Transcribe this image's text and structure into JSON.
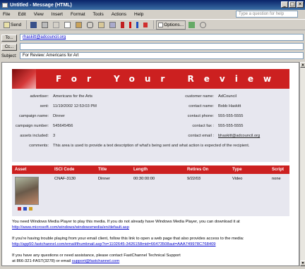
{
  "window": {
    "title": "Untitled - Message (HTML)",
    "minimize": "_",
    "maximize": "□",
    "close": "✕"
  },
  "menu": [
    "File",
    "Edit",
    "View",
    "Insert",
    "Format",
    "Tools",
    "Actions",
    "Help"
  ],
  "help_placeholder": "Type a question for help",
  "toolbar": {
    "send": "Send",
    "options": "Options..."
  },
  "header": {
    "to_label": "To...",
    "to_value": "rhaskitt@adcouncil.org",
    "cc_label": "Cc...",
    "cc_value": "",
    "subject_label": "Subject:",
    "subject_value": "For Review: Americans for Art"
  },
  "banner": {
    "text": "For Your Review"
  },
  "info": {
    "advertiser_label": "advertiser:",
    "advertiser": "Americans for the Arts",
    "sent_label": "sent:",
    "sent": "11/19/2002 12:53:03 PM",
    "campaign_name_label": "campaign name:",
    "campaign_name": "Dinner",
    "campaign_number_label": "campaign number:",
    "campaign_number": "545645456",
    "assets_included_label": "assets included:",
    "assets_included": "3",
    "comments_label": "comments:",
    "comments": "This area is used to provide a text description of what's being sent and what action is expected of the recipient.",
    "customer_name_label": "customer name:",
    "customer_name": "AdCouncil",
    "contact_name_label": "contact name:",
    "contact_name": "Bobb Haskitt",
    "contact_phone_label": "contact phone:",
    "contact_phone": "555-555-5555",
    "contact_fax_label": "contact fax :",
    "contact_fax": "555-555-5555",
    "contact_email_label": "contact email :",
    "contact_email": "bhaskitt@adcouncil.org"
  },
  "table": {
    "headers": [
      "Asset",
      "ISCI Code",
      "Title",
      "Length",
      "Retires On",
      "Type",
      "Script"
    ],
    "row": {
      "isci": "CNAF-3130",
      "title": "Dinner",
      "length": "00:30:00:00",
      "retires": "9/22/03",
      "type": "Video",
      "script": "none"
    }
  },
  "paragraphs": {
    "p1": "You need Windows Media Player to play this media. If you do not already have Windows Media Player, you can download it at",
    "p1_link": "http://www.microsoft.com/windows/windowsmedia/en/default.asp",
    "p2": "If you're having trouble playing from your email client, follow this link to open a web page that also provides access to the media:",
    "p2_link": "http://app50.fastchannel.com/email/thumbnail.asp?o=1102645-3426158mid=66473508aut=AAA749978C768409",
    "p3": "If you have any questions or need assistance, please contact FastChannel Technical Support",
    "p3b": "at 866-321-FAST(3278) or email",
    "p3_link": "support@fastchannel.com"
  },
  "colors": {
    "accent": "#cc2020",
    "panel": "#e7e7ef",
    "titlebar": "#0a246a"
  }
}
